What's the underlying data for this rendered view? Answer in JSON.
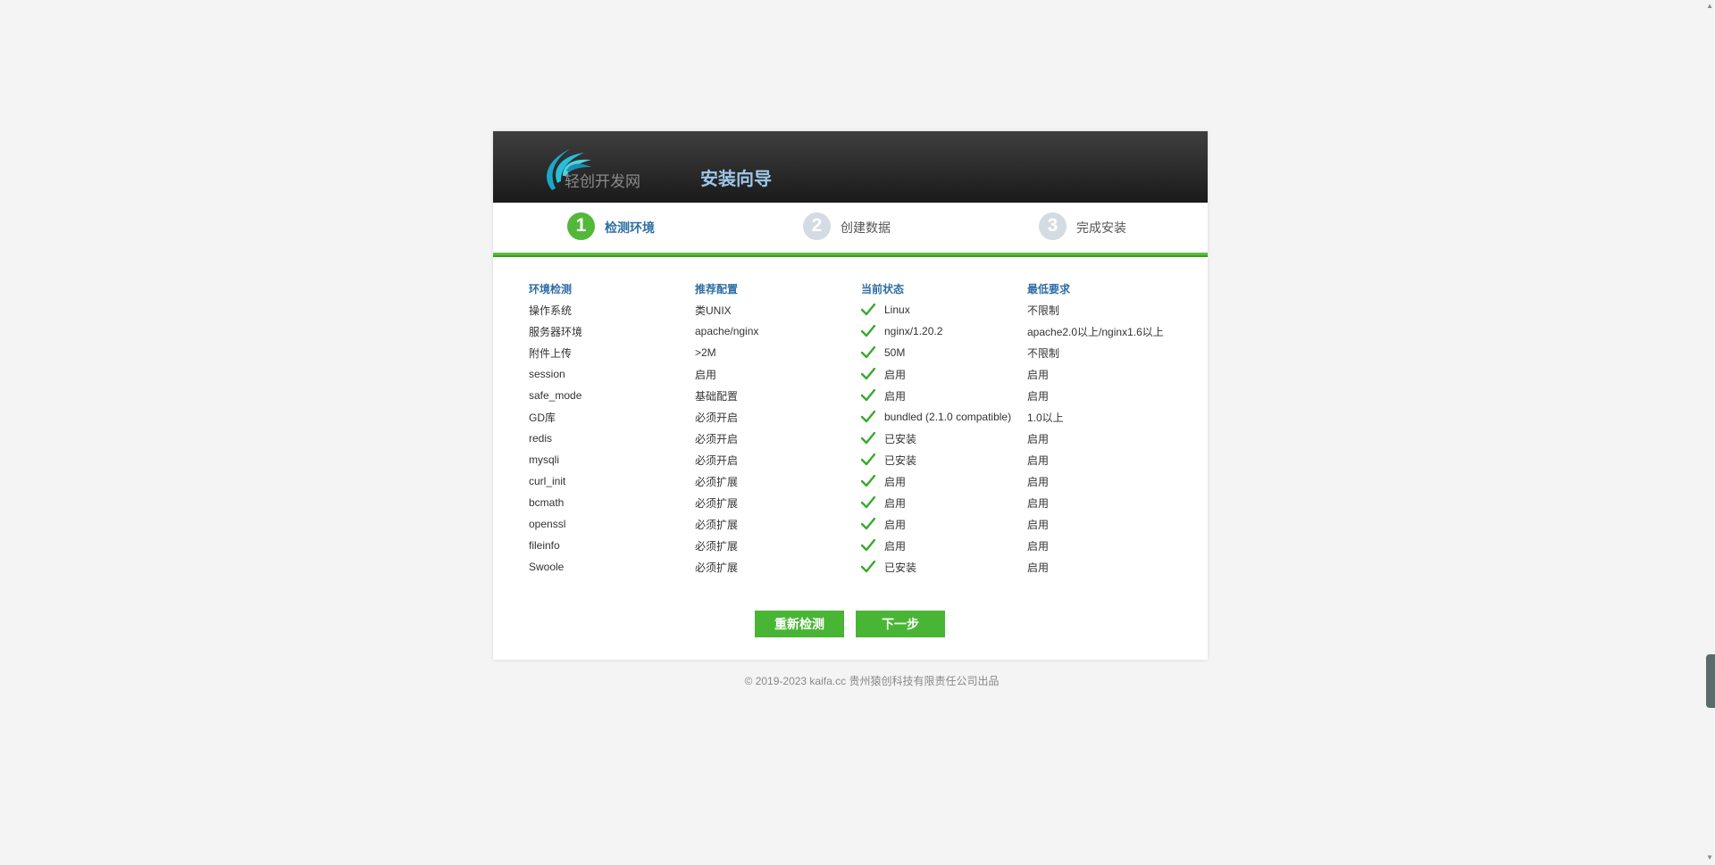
{
  "header": {
    "logo_text": "轻创开发网",
    "title": "安装向导"
  },
  "steps": [
    {
      "number": "1",
      "label": "检测环境",
      "active": true
    },
    {
      "number": "2",
      "label": "创建数据",
      "active": false
    },
    {
      "number": "3",
      "label": "完成安装",
      "active": false
    }
  ],
  "table": {
    "headers": [
      "环境检测",
      "推荐配置",
      "当前状态",
      "最低要求"
    ],
    "rows": [
      [
        "操作系统",
        "类UNIX",
        "Linux",
        "不限制"
      ],
      [
        "服务器环境",
        "apache/nginx",
        "nginx/1.20.2",
        "apache2.0以上/nginx1.6以上"
      ],
      [
        "附件上传",
        ">2M",
        "50M",
        "不限制"
      ],
      [
        "session",
        "启用",
        "启用",
        "启用"
      ],
      [
        "safe_mode",
        "基础配置",
        "启用",
        "启用"
      ],
      [
        "GD库",
        "必须开启",
        "bundled (2.1.0 compatible)",
        "1.0以上"
      ],
      [
        "redis",
        "必须开启",
        "已安装",
        "启用"
      ],
      [
        "mysqli",
        "必须开启",
        "已安装",
        "启用"
      ],
      [
        "curl_init",
        "必须扩展",
        "启用",
        "启用"
      ],
      [
        "bcmath",
        "必须扩展",
        "启用",
        "启用"
      ],
      [
        "openssl",
        "必须扩展",
        "启用",
        "启用"
      ],
      [
        "fileinfo",
        "必须扩展",
        "启用",
        "启用"
      ],
      [
        "Swoole",
        "必须扩展",
        "已安装",
        "启用"
      ]
    ]
  },
  "buttons": {
    "recheck": "重新检测",
    "next": "下一步"
  },
  "footer": {
    "text": "© 2019-2023 kaifa.cc 贵州猿创科技有限责任公司出品"
  },
  "colors": {
    "accent_green": "#49b534",
    "heading_blue": "#2e6da4",
    "header_dark": "#1a1a1a",
    "title_blue": "#9ec7ea"
  },
  "icons": {
    "status": "check-icon",
    "logo": "swoosh-logo-icon"
  }
}
